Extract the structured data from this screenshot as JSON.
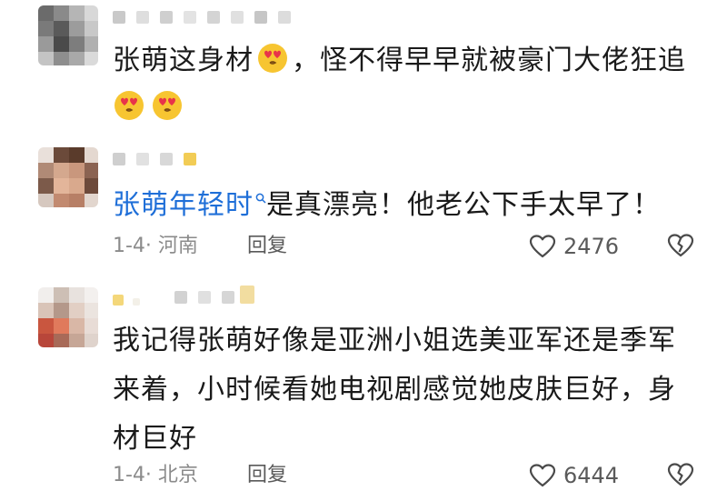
{
  "comments": [
    {
      "text_parts": [
        "张萌这身材",
        "，怪不得早早就被豪门大佬狂追"
      ],
      "emoji": "heart-eyes-kiss-emoji"
    },
    {
      "mention": "张萌年轻时",
      "text": "是真漂亮！他老公下手太早了！",
      "date_location": "1-4· 河南",
      "reply_label": "回复",
      "likes": "2476"
    },
    {
      "text_lines": [
        "我记得张萌好像是亚洲小姐选美亚军还是季军",
        "来着，小时候看她电视剧感觉她皮肤巨好，身",
        "材巨好"
      ],
      "date_location": "1-4· 北京",
      "reply_label": "回复",
      "likes": "6444"
    }
  ],
  "colors": {
    "mention": "#1f6fd8",
    "meta": "#8b8b8b",
    "text": "#1a1a1a"
  },
  "icons": [
    "search-icon",
    "heart-outline-icon",
    "broken-heart-icon"
  ]
}
